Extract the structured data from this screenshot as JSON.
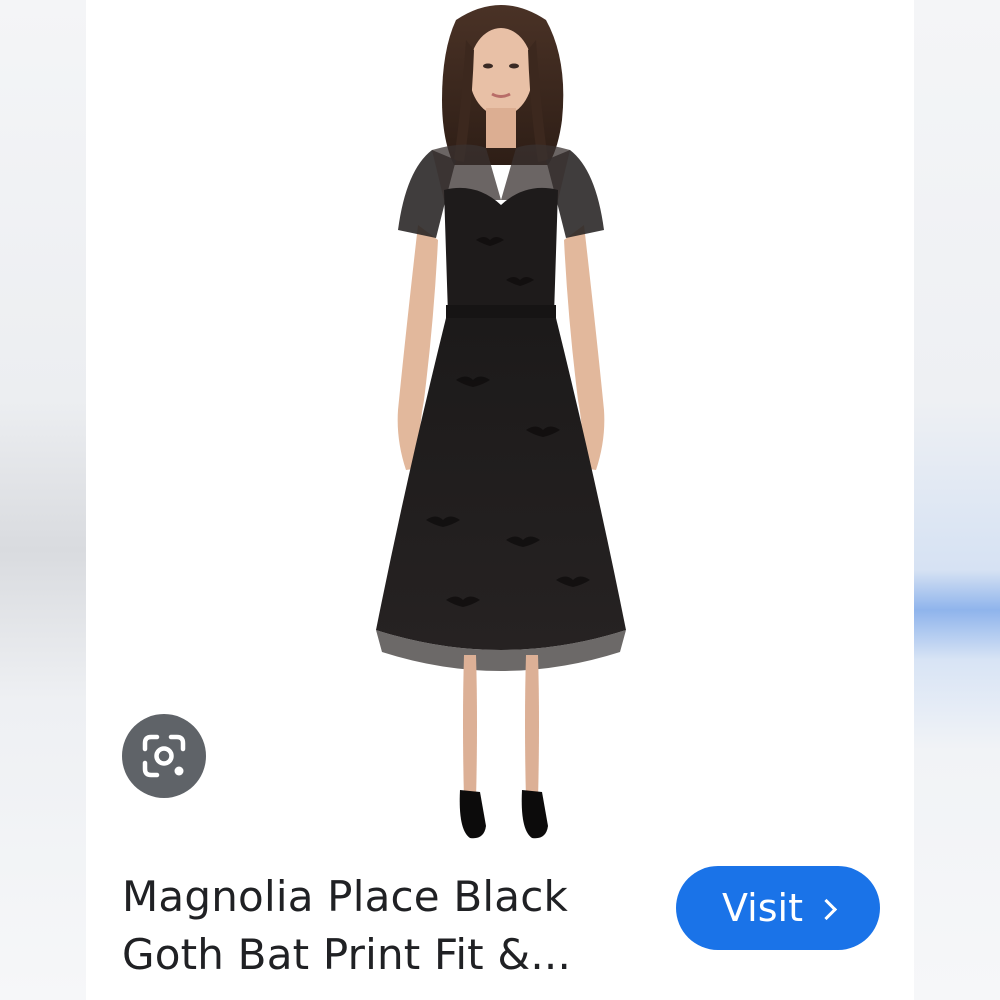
{
  "product": {
    "title": "Magnolia Place Black Goth Bat Print Fit &..."
  },
  "actions": {
    "visit_label": "Visit"
  },
  "icons": {
    "lens": "google-lens-icon",
    "visit_chevron": "chevron-right-icon"
  },
  "colors": {
    "visit_button": "#1a73e8",
    "lens_button": "#5f6368",
    "title_text": "#202124"
  }
}
